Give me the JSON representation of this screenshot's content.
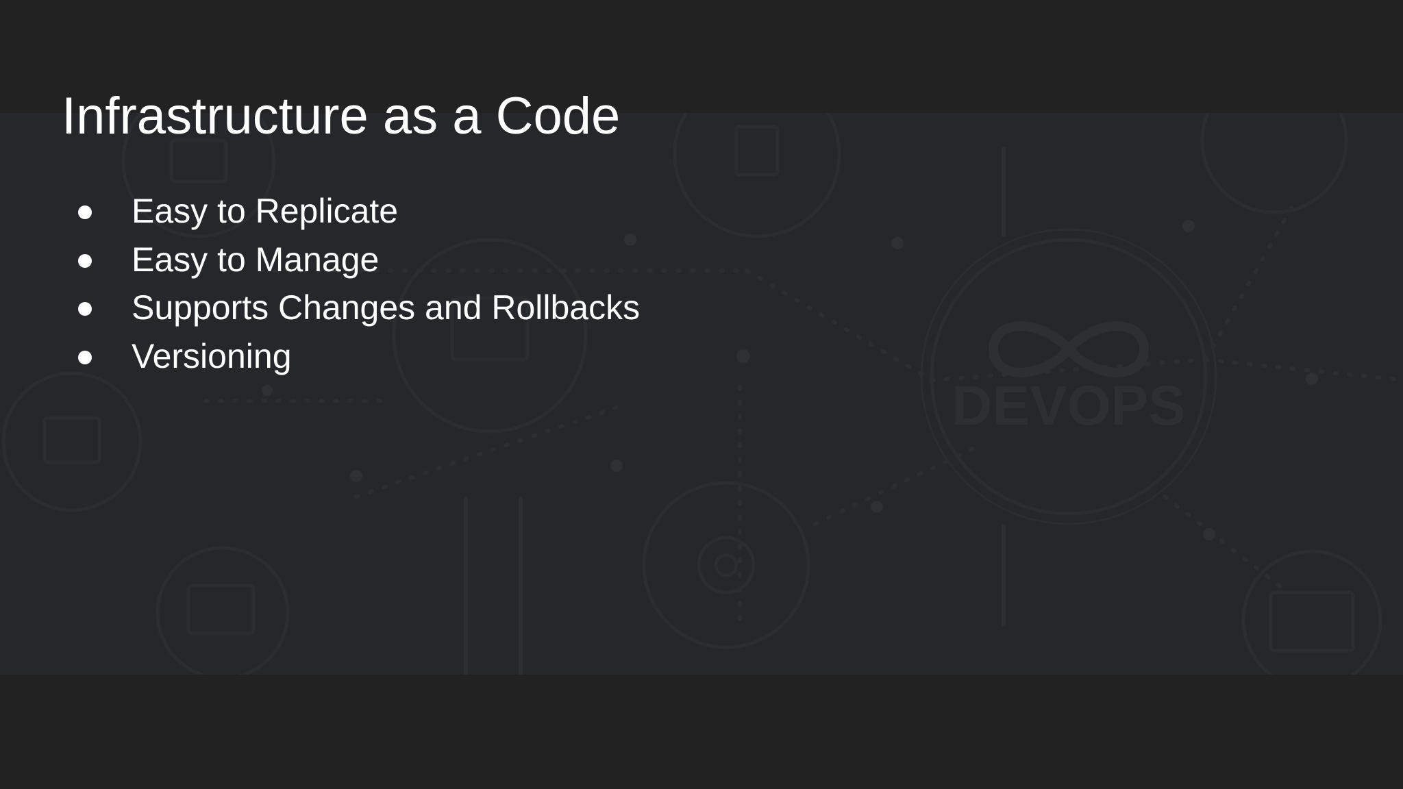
{
  "slide": {
    "title": "Infrastructure as a Code",
    "bullets": [
      "Easy to Replicate",
      "Easy to Manage",
      "Supports Changes and Rollbacks",
      "Versioning"
    ],
    "background_watermark_text": "DEVOPS"
  },
  "colors": {
    "background": "#222222",
    "band": "#25272a",
    "text": "#ffffff",
    "watermark": "#2d3032"
  },
  "icons": [
    "infinity-icon",
    "monitor-icon",
    "gear-icon",
    "chart-icon",
    "cloud-icon"
  ]
}
